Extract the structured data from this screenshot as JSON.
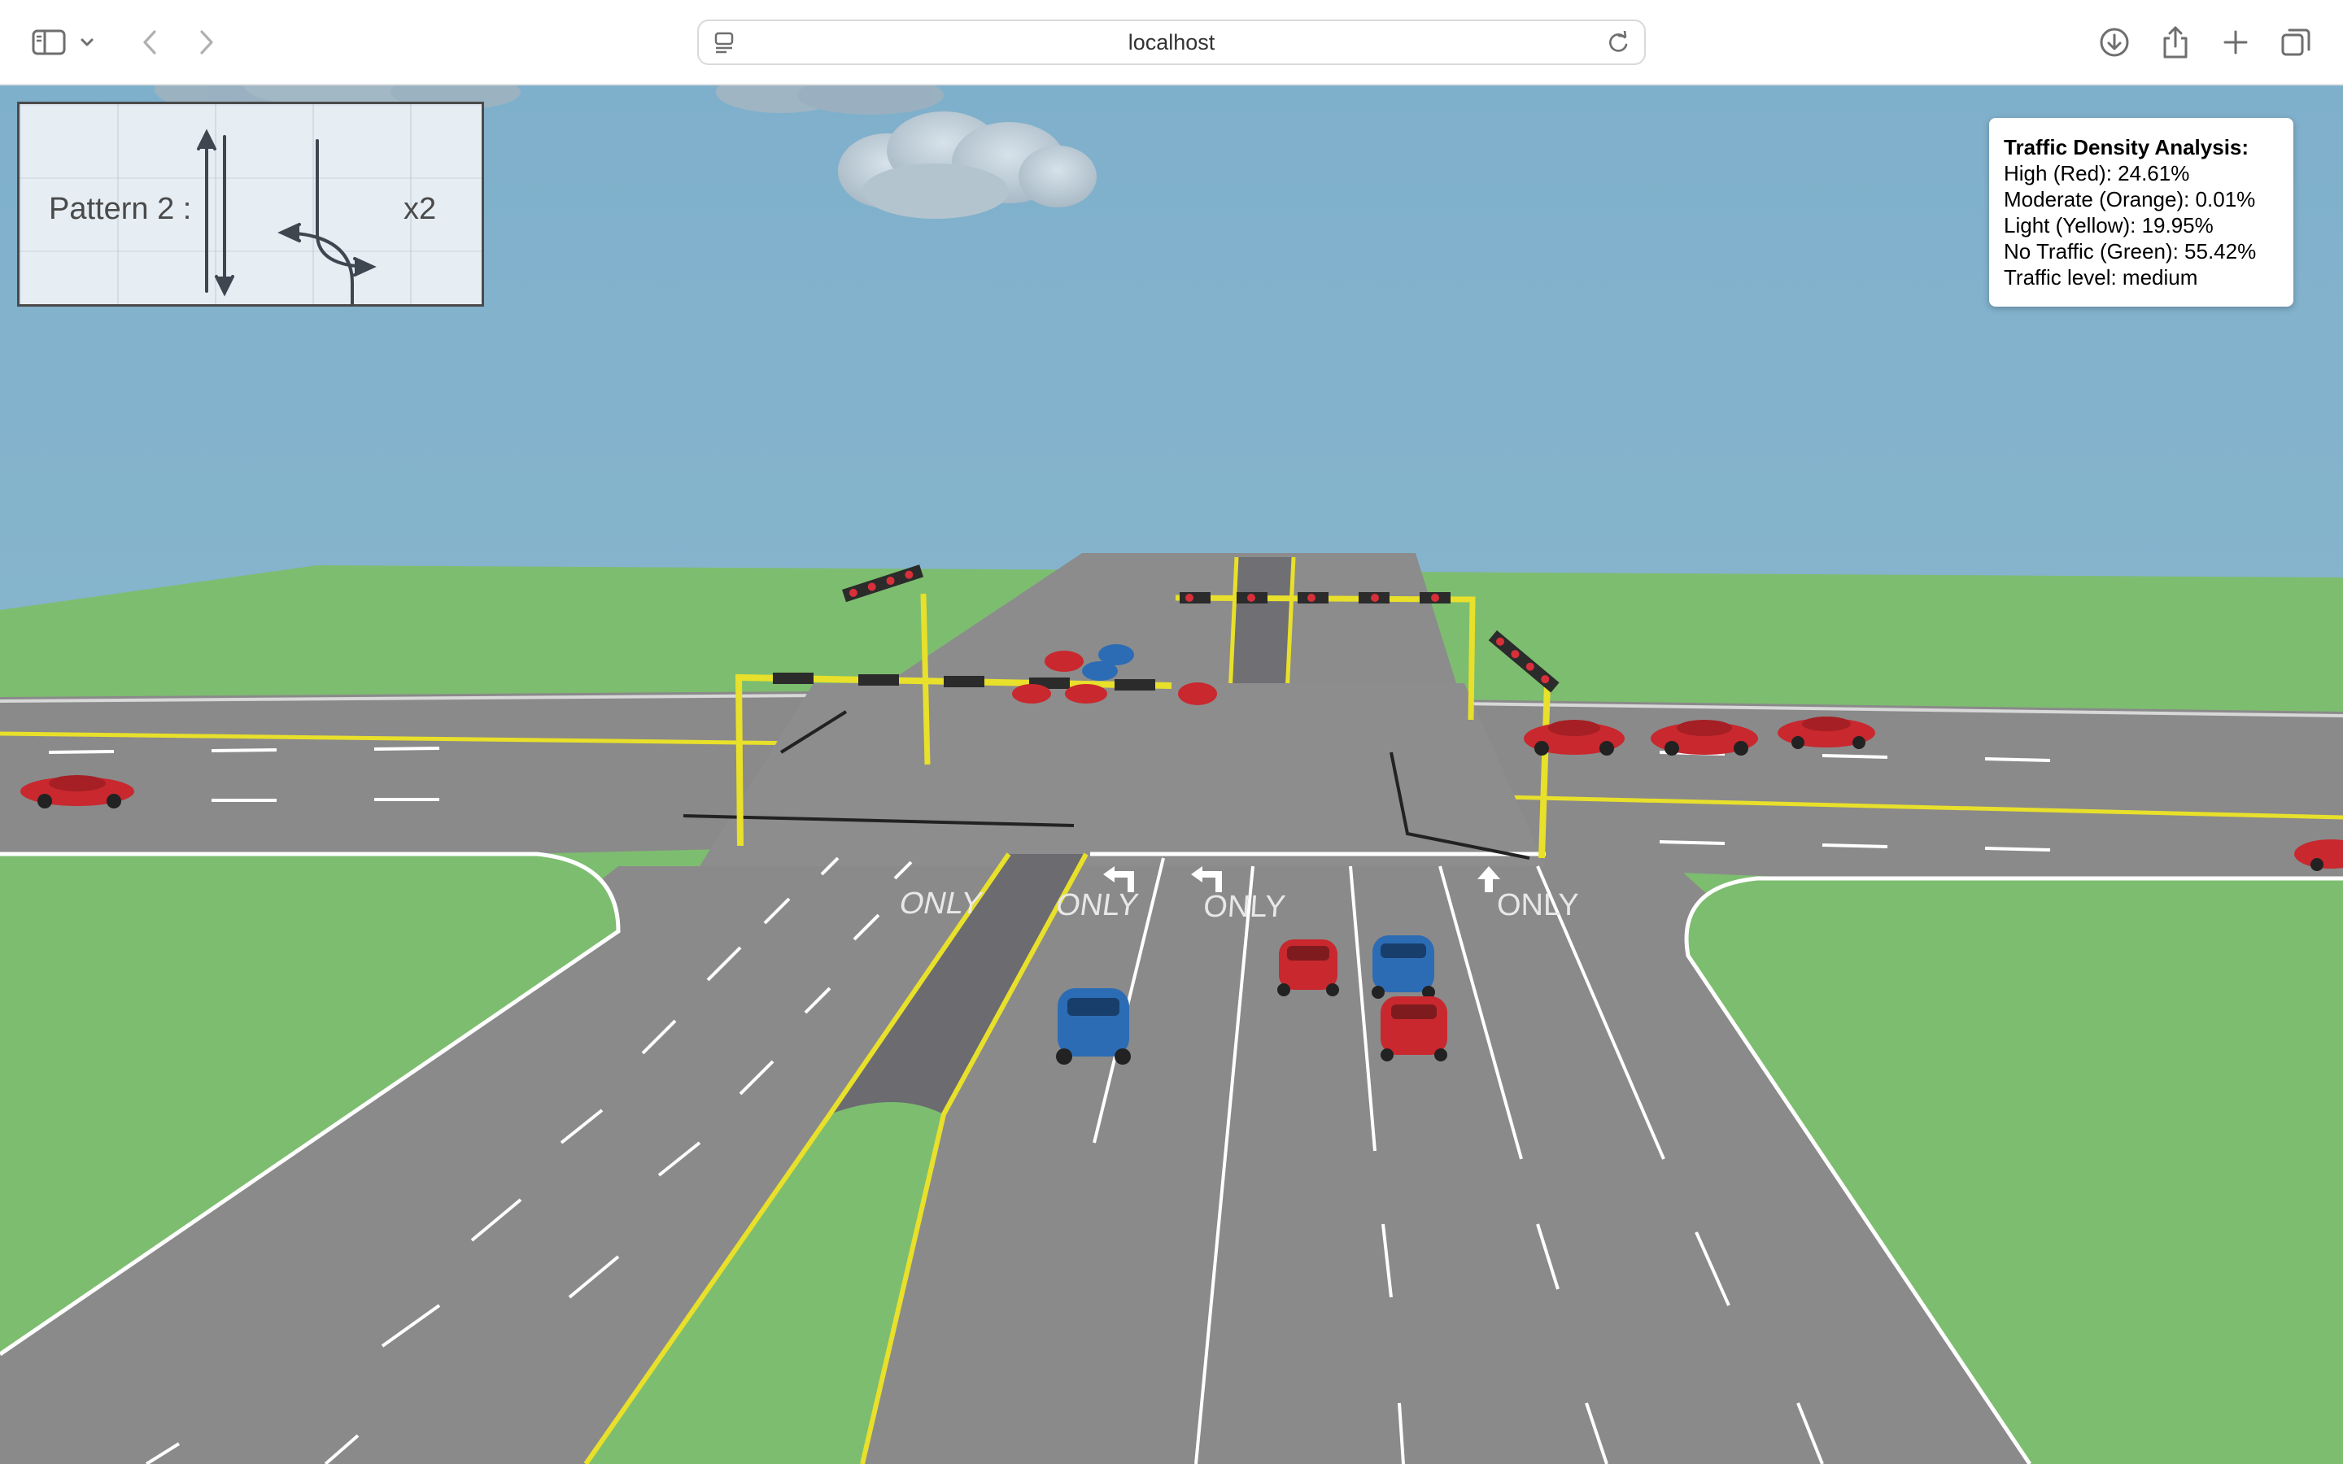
{
  "browser": {
    "address": "localhost",
    "icons": {
      "sidebar": "sidebar-icon",
      "chevron": "chevron-down-icon",
      "back": "back-arrow-icon",
      "forward": "forward-arrow-icon",
      "site": "site-settings-icon",
      "reload": "reload-icon",
      "download": "download-icon",
      "share": "share-icon",
      "new_tab": "plus-icon",
      "tabs": "tab-overview-icon"
    }
  },
  "pattern": {
    "label": "Pattern 2 :",
    "multiplier": "x2"
  },
  "density": {
    "title": "Traffic Density Analysis:",
    "high": "High (Red): 24.61%",
    "moderate": "Moderate (Orange): 0.01%",
    "light": "Light (Yellow): 19.95%",
    "none": "No Traffic (Green): 55.42%",
    "level": "Traffic level: medium"
  },
  "road_markings": {
    "only": "ONLY"
  },
  "colors": {
    "sky": "#82b1cb",
    "grass": "#7dbb6f",
    "road": "#8a8a8a",
    "median_yellow": "#e8e02a",
    "car_red": "#c8282e",
    "car_blue": "#2b6cb5"
  }
}
